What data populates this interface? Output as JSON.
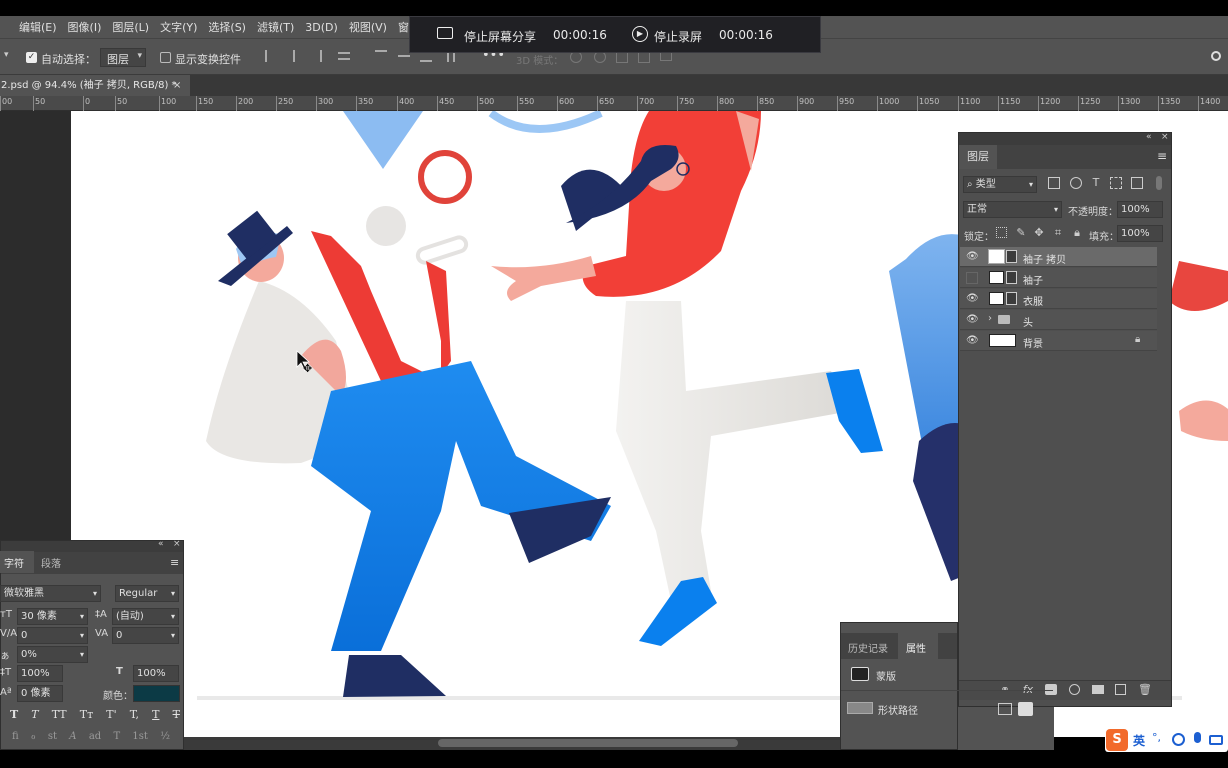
{
  "menu": [
    "编辑(E)",
    "图像(I)",
    "图层(L)",
    "文字(Y)",
    "选择(S)",
    "滤镜(T)",
    "3D(D)",
    "视图(V)",
    "窗口(V"
  ],
  "options": {
    "auto_select_label": "自动选择：",
    "auto_select_value": "图层",
    "show_transform_label": "显示变换控件",
    "mode3d_label": "3D 模式："
  },
  "document": {
    "tab_title": "2.psd @ 94.4% (袖子 拷贝, RGB/8) *",
    "close_glyph": "×"
  },
  "ruler_labels": [
    "00",
    "50",
    "0",
    "50",
    "100",
    "150",
    "200",
    "250",
    "300",
    "350",
    "400",
    "450",
    "500",
    "550",
    "600",
    "650",
    "700",
    "750",
    "800",
    "850",
    "900",
    "950",
    "1000",
    "1050",
    "1100",
    "1150",
    "1200",
    "1250",
    "1300",
    "1350",
    "1400"
  ],
  "recording": {
    "stop_share_label": "停止屏幕分享",
    "share_time": "00:00:16",
    "stop_record_label": "停止录屏",
    "record_time": "00:00:16"
  },
  "layers_panel": {
    "tab": "图层",
    "filter_type": "类型",
    "blend_mode": "正常",
    "opacity_label": "不透明度：",
    "opacity": "100%",
    "lock_label": "锁定：",
    "fill_label": "填充：",
    "fill": "100%",
    "layers": [
      {
        "name": "袖子 拷贝",
        "visible": true,
        "selected": true,
        "has_mask": true
      },
      {
        "name": "袖子",
        "visible": false,
        "selected": false,
        "has_mask": true
      },
      {
        "name": "衣服",
        "visible": true,
        "selected": false,
        "has_mask": true
      },
      {
        "name": "头",
        "visible": true,
        "selected": false,
        "group": true
      },
      {
        "name": "背景",
        "visible": true,
        "selected": false,
        "locked": true
      }
    ]
  },
  "character_panel": {
    "tabs": [
      "字符",
      "段落"
    ],
    "font_family": "微软雅黑",
    "font_style": "Regular",
    "font_size": "30 像素",
    "leading": "(自动)",
    "kerning": "0",
    "tracking": "0",
    "scale_pct": "0%",
    "vscale": "100%",
    "hscale": "100%",
    "baseline": "0 像素",
    "color_label": "颜色：",
    "color_value": "#0c3a45",
    "style_buttons": [
      "T",
      "T",
      "TT",
      "Tт",
      "T'",
      "T,",
      "T",
      "T"
    ],
    "extra_buttons": [
      "fi",
      "ℴ",
      "st",
      "A",
      "ad",
      "T",
      "1st",
      "½"
    ]
  },
  "history_panel": {
    "tabs": [
      "历史记录",
      "属性"
    ],
    "mask_label": "蒙版",
    "path_label": "形状路径"
  },
  "ime": {
    "lang": "英",
    "punct": "°,"
  }
}
